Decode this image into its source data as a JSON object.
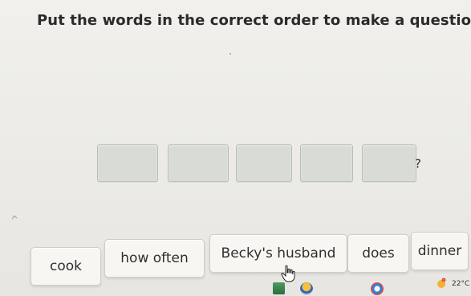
{
  "instruction": {
    "title": "Put the words in the correct order to make a question."
  },
  "answer_area": {
    "slot_count": 5,
    "question_mark": "?"
  },
  "word_bank": [
    {
      "label": "cook"
    },
    {
      "label": "how often"
    },
    {
      "label": "Becky's husband"
    },
    {
      "label": "does"
    },
    {
      "label": "dinner"
    }
  ],
  "taskbar": {
    "temperature": "22°C",
    "icons": [
      "app-green-icon",
      "chrome-like-icon",
      "browser-icon",
      "weather-icon"
    ]
  },
  "cursor": {
    "type": "hand-pointer"
  }
}
